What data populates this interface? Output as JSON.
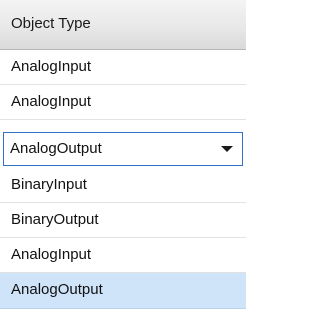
{
  "header": {
    "column_label": "Object Type"
  },
  "rows_above": [
    {
      "value": "AnalogInput"
    },
    {
      "value": "AnalogInput"
    }
  ],
  "dropdown": {
    "selected_value": "AnalogOutput",
    "icon": "chevron-down-icon",
    "border_color": "#2f73c9"
  },
  "rows_below": [
    {
      "value": "BinaryInput"
    },
    {
      "value": "BinaryOutput"
    },
    {
      "value": "AnalogInput"
    },
    {
      "value": "AnalogOutput",
      "selected": true
    }
  ],
  "colors": {
    "selected_row": "#cfe3f9",
    "header_bg": "#e8e8e8"
  }
}
